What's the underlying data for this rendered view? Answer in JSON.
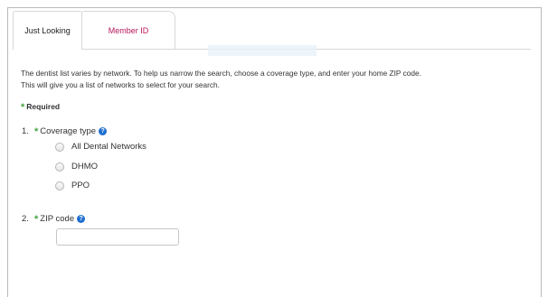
{
  "tabs": [
    {
      "label": "Just Looking",
      "active": true
    },
    {
      "label": "Member ID",
      "active": false
    }
  ],
  "description": {
    "line1": "The dentist list varies by network. To help us narrow the search, choose a coverage type, and enter your home ZIP code.",
    "line2": "This will give you a list of networks to select for your search."
  },
  "required_label": "Required",
  "required_marker": "*",
  "coverage": {
    "number": "1.",
    "label": "Coverage type",
    "options": [
      "All Dental Networks",
      "DHMO",
      "PPO"
    ]
  },
  "zip": {
    "number": "2.",
    "label": "ZIP code",
    "value": "",
    "placeholder": ""
  },
  "help_glyph": "?",
  "colors": {
    "accent_tab": "#b8155c",
    "required_star": "#41a341",
    "help_icon": "#1f6fd1"
  }
}
